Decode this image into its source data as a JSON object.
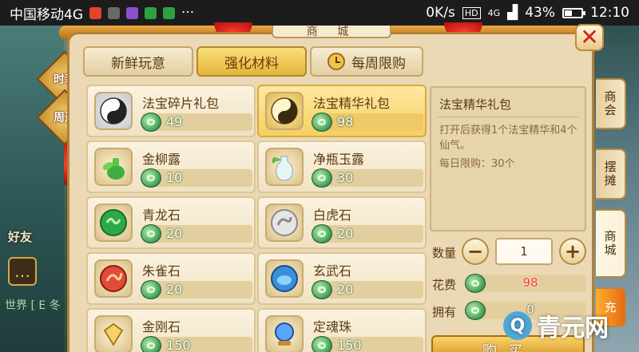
{
  "status_bar": {
    "carrier": "中国移动4G",
    "network_speed": "0K/s",
    "signal": "4G",
    "battery": "43%",
    "time": "12:10"
  },
  "shop": {
    "title": "商 城",
    "tabs": [
      {
        "label": "新鲜玩意",
        "active": false
      },
      {
        "label": "强化材料",
        "active": true
      },
      {
        "label": "每周限购",
        "active": false
      }
    ],
    "items": [
      {
        "name": "法宝碎片礼包",
        "price": "49",
        "icon": "taiji-icon",
        "selected": false
      },
      {
        "name": "法宝精华礼包",
        "price": "98",
        "icon": "taiji-icon",
        "selected": true
      },
      {
        "name": "金柳露",
        "price": "10",
        "icon": "potion-bottle-icon",
        "selected": false
      },
      {
        "name": "净瓶玉露",
        "price": "30",
        "icon": "vase-icon",
        "selected": false
      },
      {
        "name": "青龙石",
        "price": "20",
        "icon": "dragon-stone-icon",
        "selected": false
      },
      {
        "name": "白虎石",
        "price": "20",
        "icon": "tiger-stone-icon",
        "selected": false
      },
      {
        "name": "朱雀石",
        "price": "20",
        "icon": "phoenix-stone-icon",
        "selected": false
      },
      {
        "name": "玄武石",
        "price": "20",
        "icon": "tortoise-stone-icon",
        "selected": false
      },
      {
        "name": "金刚石",
        "price": "150",
        "icon": "diamond-icon",
        "selected": false
      },
      {
        "name": "定魂珠",
        "price": "150",
        "icon": "orb-icon",
        "selected": false
      }
    ],
    "detail": {
      "title": "法宝精华礼包",
      "description": "打开后获得1个法宝精华和4个仙气。",
      "limit": "每日限购：30个"
    },
    "purchase": {
      "quantity_label": "数量",
      "quantity": "1",
      "minus": "−",
      "plus": "+",
      "cost_label": "花费",
      "cost": "98",
      "own_label": "拥有",
      "own": "0",
      "buy_label": "购买"
    },
    "side_tabs": [
      {
        "label": "商会",
        "active": false
      },
      {
        "label": "摆摊",
        "active": false
      },
      {
        "label": "商城",
        "active": true
      },
      {
        "label": "充",
        "active": false
      }
    ]
  },
  "left_ui": {
    "btn_1": "时装",
    "btn_2": "周边",
    "friends": "好友",
    "world_chat": "世界 [ E 冬"
  },
  "watermark": "青元网",
  "colors": {
    "accent_gold": "#e4b53a",
    "price_red": "#ff3b3b",
    "close_red": "#d2201c"
  }
}
